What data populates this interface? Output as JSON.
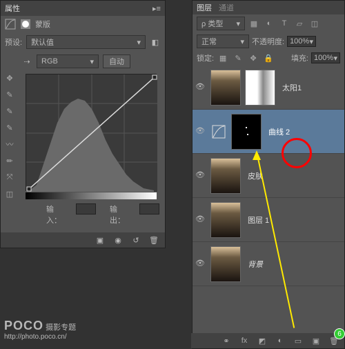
{
  "properties": {
    "tab_props": "属性",
    "mask_label": "蒙版",
    "preset_label": "预设:",
    "preset_value": "默认值",
    "channel_value": "RGB",
    "auto_btn": "自动",
    "input_label": "输入：",
    "output_label": "输出：",
    "chevron": "▾"
  },
  "layersPanel": {
    "tab_layers": "图层",
    "tab_channels": "通道",
    "kind_label": "ρ 类型",
    "blend_mode": "正常",
    "opacity_label": "不透明度:",
    "opacity_value": "100%",
    "lock_label": "锁定:",
    "fill_label": "填充:",
    "fill_value": "100%",
    "layers": [
      {
        "name": "太阳1",
        "mask": "white"
      },
      {
        "name": "曲线 2",
        "mask": "black",
        "selected": true,
        "adj": true
      },
      {
        "name": "皮肤"
      },
      {
        "name": "图层 1"
      },
      {
        "name": "背景",
        "italic": true
      }
    ]
  },
  "watermark": {
    "brand": "POCO",
    "sub": "摄影专题",
    "url": "http://photo.poco.cn/"
  },
  "badge": "6"
}
